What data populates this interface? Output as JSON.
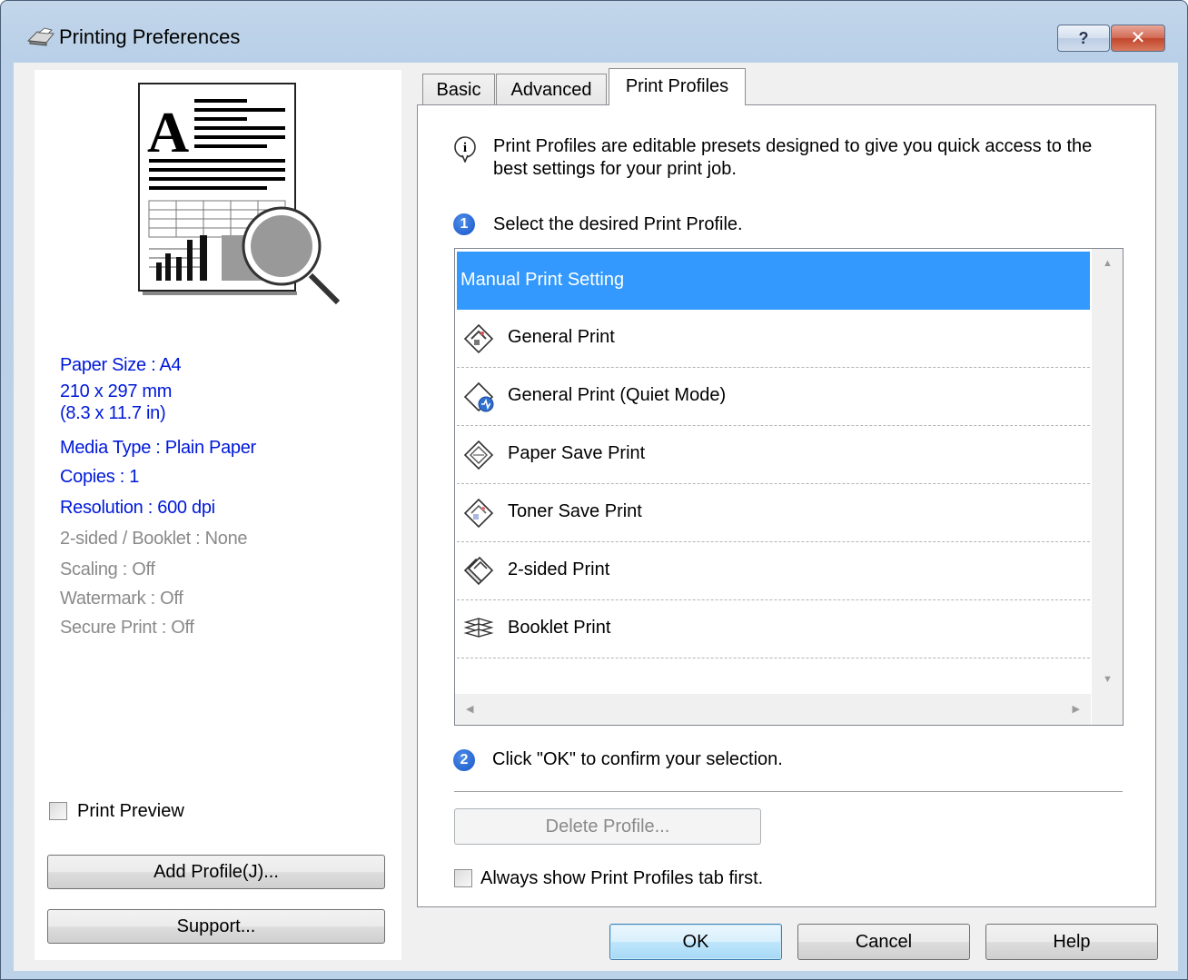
{
  "window": {
    "title": "Printing Preferences",
    "help_glyph": "?",
    "close_glyph": "✕"
  },
  "left_panel": {
    "settings_blue": [
      "Paper Size : A4",
      "210 x 297 mm",
      "(8.3 x 11.7 in)",
      "Media Type : Plain Paper",
      "Copies : 1",
      "Resolution : 600 dpi"
    ],
    "settings_gray": [
      "2-sided / Booklet : None",
      "Scaling : Off",
      "Watermark : Off",
      "Secure Print : Off"
    ],
    "print_preview_label": "Print Preview",
    "add_profile_label": "Add Profile(J)...",
    "support_label": "Support..."
  },
  "tabs": [
    {
      "label": "Basic",
      "active": false
    },
    {
      "label": "Advanced",
      "active": false
    },
    {
      "label": "Print Profiles",
      "active": true
    }
  ],
  "profiles_page": {
    "intro_line1": "Print Profiles are editable presets designed to give you quick access to the",
    "intro_line2": "best settings for your print job.",
    "step1_number": "1",
    "step1_text": "Select the desired Print Profile.",
    "profiles": [
      {
        "label": "Manual Print Setting",
        "selected": true,
        "icon": "none"
      },
      {
        "label": "General Print",
        "selected": false,
        "icon": "general-print-icon"
      },
      {
        "label": "General Print (Quiet Mode)",
        "selected": false,
        "icon": "quiet-mode-icon"
      },
      {
        "label": "Paper Save Print",
        "selected": false,
        "icon": "paper-save-icon"
      },
      {
        "label": "Toner Save Print",
        "selected": false,
        "icon": "toner-save-icon"
      },
      {
        "label": "2-sided Print",
        "selected": false,
        "icon": "two-sided-icon"
      },
      {
        "label": "Booklet Print",
        "selected": false,
        "icon": "booklet-icon"
      }
    ],
    "step2_number": "2",
    "step2_text": "Click \"OK\" to confirm your selection.",
    "delete_profile_label": "Delete Profile...",
    "always_show_label": "Always show Print Profiles tab first."
  },
  "footer": {
    "ok_label": "OK",
    "cancel_label": "Cancel",
    "help_label": "Help"
  },
  "colors": {
    "selection": "#3399ff",
    "settings_blue": "#0019d8",
    "settings_gray": "#8a8a8a"
  }
}
